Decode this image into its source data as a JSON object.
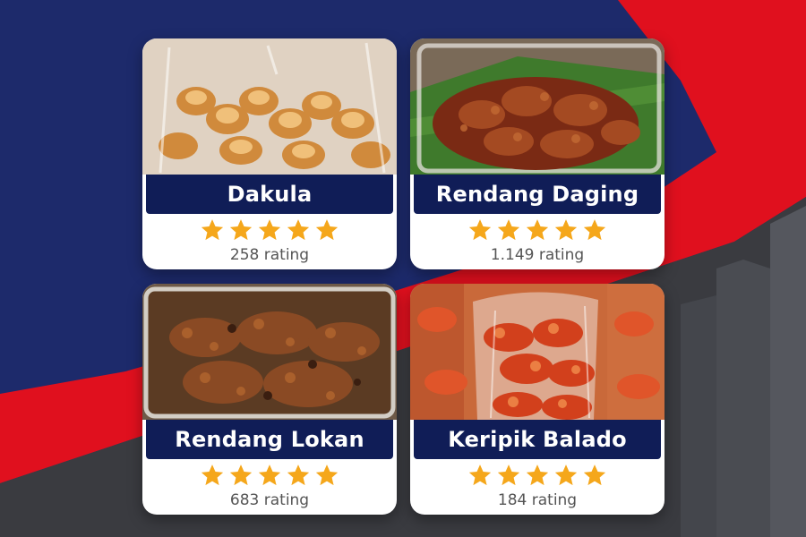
{
  "colors": {
    "navy": "#1d2a6b",
    "red": "#e0101e",
    "dark_gray": "#3a3b40",
    "label_bar": "#101d57",
    "star": "#f5a71b"
  },
  "products": [
    {
      "name": "Dakula",
      "stars": 5,
      "rating_text": "258 rating",
      "image": "dakula-crackers-photo"
    },
    {
      "name": "Rendang Daging",
      "stars": 5,
      "rating_text": "1.149 rating",
      "image": "rendang-daging-photo"
    },
    {
      "name": "Rendang Lokan",
      "stars": 5,
      "rating_text": "683 rating",
      "image": "rendang-lokan-photo"
    },
    {
      "name": "Keripik Balado",
      "stars": 5,
      "rating_text": "184 rating",
      "image": "keripik-balado-photo"
    }
  ]
}
